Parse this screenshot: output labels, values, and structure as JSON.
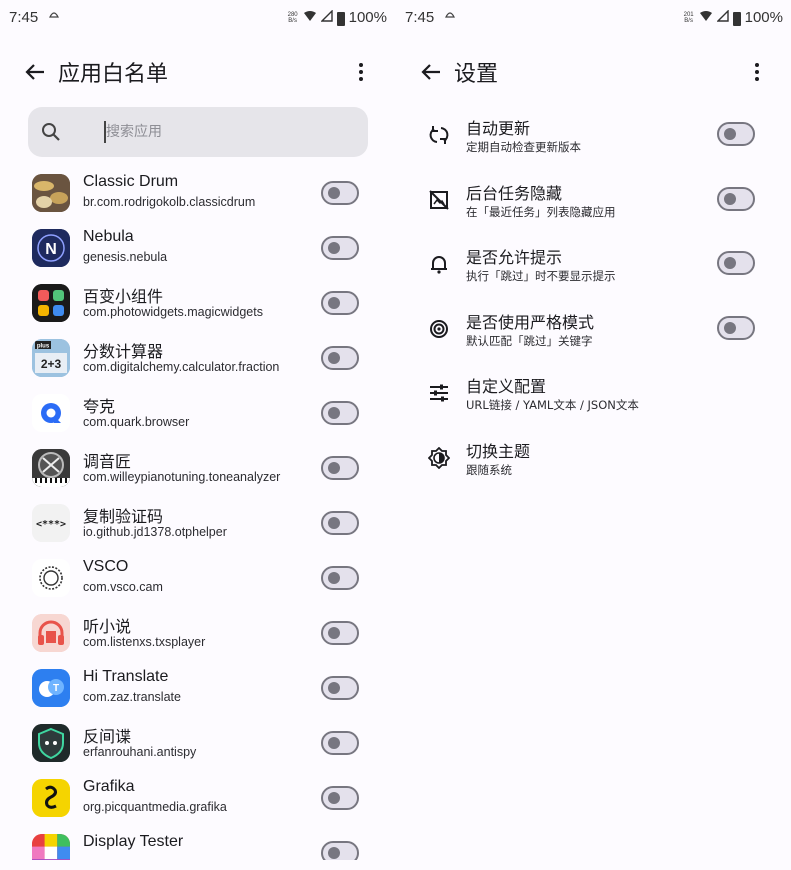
{
  "left": {
    "status": {
      "time": "7:45",
      "speed": "280\nB/s",
      "battery": "100%"
    },
    "title": "应用白名单",
    "search_placeholder": "搜索应用",
    "apps": [
      {
        "name": "Classic Drum",
        "pkg": "br.com.rodrigokolb.classicdrum",
        "icon": "drum-icon",
        "bg": "#5a4636",
        "fg": "#e8c891",
        "glyph": ""
      },
      {
        "name": "Nebula",
        "pkg": "genesis.nebula",
        "icon": "nebula-icon",
        "bg": "#1e2a5e",
        "fg": "#ffffff",
        "glyph": "N"
      },
      {
        "name": "百变小组件",
        "pkg": "com.photowidgets.magicwidgets",
        "icon": "widgets-icon",
        "bg": "#1a1a1a",
        "fg": "#ffffff",
        "glyph": ""
      },
      {
        "name": "分数计算器",
        "pkg": "com.digitalchemy.calculator.fraction",
        "icon": "calculator-icon",
        "bg": "#8ab4d6",
        "fg": "#1a1a1a",
        "glyph": "2+3"
      },
      {
        "name": "夸克",
        "pkg": "com.quark.browser",
        "icon": "quark-icon",
        "bg": "#ffffff",
        "fg": "#2b6cf6",
        "glyph": ""
      },
      {
        "name": "调音匠",
        "pkg": "com.willeypianotuning.toneanalyzer",
        "icon": "piano-tuning-icon",
        "bg": "#2a2a2a",
        "fg": "#e0e0e0",
        "glyph": ""
      },
      {
        "name": "复制验证码",
        "pkg": "io.github.jd1378.otphelper",
        "icon": "otp-icon",
        "bg": "#f2f2f2",
        "fg": "#222222",
        "glyph": "<***>"
      },
      {
        "name": "VSCO",
        "pkg": "com.vsco.cam",
        "icon": "vsco-icon",
        "bg": "#ffffff",
        "fg": "#222222",
        "glyph": ""
      },
      {
        "name": "听小说",
        "pkg": "com.listenxs.txsplayer",
        "icon": "headphones-icon",
        "bg": "#f3c7c1",
        "fg": "#e8534a",
        "glyph": ""
      },
      {
        "name": "Hi Translate",
        "pkg": "com.zaz.translate",
        "icon": "translate-icon",
        "bg": "#2d7ff0",
        "fg": "#ffffff",
        "glyph": ""
      },
      {
        "name": "反间谍",
        "pkg": "erfanrouhani.antispy",
        "icon": "antispy-icon",
        "bg": "#1f2a2a",
        "fg": "#3fd6a0",
        "glyph": ""
      },
      {
        "name": "Grafika",
        "pkg": "org.picquantmedia.grafika",
        "icon": "grafika-icon",
        "bg": "#f5d400",
        "fg": "#111111",
        "glyph": ""
      },
      {
        "name": "Display Tester",
        "pkg": "",
        "icon": "display-tester-icon",
        "bg": "#e84040",
        "fg": "#ffffff",
        "glyph": ""
      }
    ]
  },
  "right": {
    "status": {
      "time": "7:45",
      "speed": "201\nB/s",
      "battery": "100%"
    },
    "title": "设置",
    "settings": [
      {
        "title": "自动更新",
        "sub": "定期自动检查更新版本",
        "icon": "sync-icon",
        "toggle": true
      },
      {
        "title": "后台任务隐藏",
        "sub": "在「最近任务」列表隐藏应用",
        "icon": "hide-image-icon",
        "toggle": true
      },
      {
        "title": "是否允许提示",
        "sub": "执行「跳过」时不要显示提示",
        "icon": "bell-icon",
        "toggle": true
      },
      {
        "title": "是否使用严格模式",
        "sub": "默认匹配「跳过」关键字",
        "icon": "target-icon",
        "toggle": true
      },
      {
        "title": "自定义配置",
        "sub": "URL链接 / YAML文本 / JSON文本",
        "icon": "tune-icon",
        "toggle": false
      },
      {
        "title": "切换主题",
        "sub": "跟随系统",
        "icon": "theme-icon",
        "toggle": false
      }
    ]
  },
  "colors": {
    "background": "#fdfbff",
    "switch_track": "#e4e1ec",
    "switch_outline": "#777680",
    "search_bg": "#e6e5ea"
  }
}
